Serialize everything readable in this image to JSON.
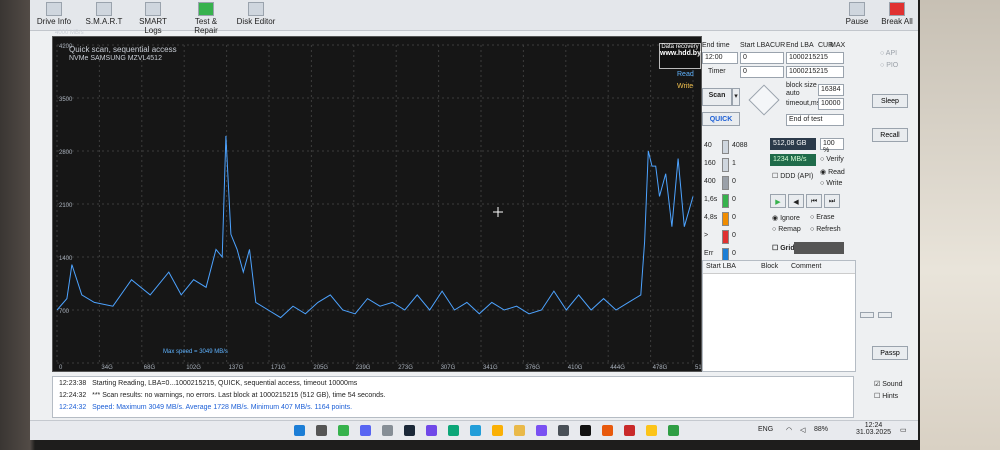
{
  "toolbar": {
    "items": [
      "Drive Info",
      "S.M.A.R.T",
      "SMART Logs",
      "Test & Repair",
      "Disk Editor"
    ],
    "pause": "Pause",
    "break_all": "Break All"
  },
  "chart": {
    "title": "Quick scan, sequential access",
    "drive": "NVMe SAMSUNG MZVL4512",
    "y_unit": "4000 MB/s",
    "data_recovery": "Data recovery",
    "site": "www.hdd.by",
    "read_label": "Read",
    "write_label": "Write",
    "max_speed": "Max speed = 3049 MB/s"
  },
  "chart_data": {
    "type": "line",
    "title": "Quick scan, sequential access",
    "ylabel": "4000 MB/s",
    "y_ticks": [
      "4200",
      "3500",
      "2800",
      "2100",
      "1400",
      "700"
    ],
    "x_ticks": [
      "0",
      "34G",
      "68G",
      "102G",
      "137G",
      "171G",
      "205G",
      "239G",
      "273G",
      "307G",
      "341G",
      "376G",
      "410G",
      "444G",
      "478G",
      "512G"
    ],
    "ylim": [
      0,
      4200
    ],
    "xlim": [
      0,
      512
    ],
    "series": [
      {
        "name": "Read",
        "x": [
          0,
          8,
          12,
          20,
          30,
          45,
          60,
          75,
          90,
          100,
          110,
          120,
          128,
          133,
          136,
          140,
          145,
          150,
          155,
          160,
          170,
          180,
          190,
          200,
          210,
          220,
          230,
          240,
          250,
          260,
          270,
          280,
          290,
          300,
          310,
          320,
          330,
          340,
          350,
          360,
          370,
          380,
          390,
          400,
          410,
          420,
          430,
          440,
          450,
          460,
          470,
          473,
          476,
          479,
          482,
          485,
          490,
          495,
          500,
          505,
          512
        ],
        "y": [
          700,
          850,
          1300,
          900,
          800,
          750,
          1100,
          900,
          1200,
          900,
          1100,
          1000,
          1500,
          1400,
          3000,
          1700,
          1500,
          1200,
          1500,
          800,
          700,
          600,
          750,
          650,
          800,
          900,
          700,
          650,
          850,
          750,
          800,
          700,
          900,
          700,
          950,
          700,
          800,
          650,
          800,
          700,
          750,
          650,
          700,
          950,
          700,
          900,
          700,
          850,
          700,
          800,
          900,
          1600,
          2800,
          2600,
          2600,
          2200,
          2500,
          1800,
          2700,
          1800,
          2200
        ]
      }
    ]
  },
  "panel": {
    "end_time": "End time",
    "start_lba": "Start LBA",
    "cur": "CUR",
    "end_lba": "End LBA",
    "max": "MAX",
    "time_value": "12:00",
    "start_lba_value": "0",
    "end_lba_value": "1000215215",
    "timer_label": "Timer",
    "timer_value": "0",
    "end_lba_value2": "1000215215",
    "block_size_label": "block size",
    "auto_label": "auto",
    "block_size_value": "16384",
    "timeout_label": "timeout,ms",
    "timeout_value": "10000",
    "scan_button": "Scan",
    "quick_button": "QUICK",
    "end_of_test": "End of test",
    "size_value": "512,08 GB",
    "percent_value": "100",
    "percent_sign": "%",
    "speed_value": "1234 MB/s",
    "verify": "Verify",
    "read": "Read",
    "write": "Write",
    "ddd_api": "DDD (API)",
    "ignore": "Ignore",
    "erase": "Erase",
    "remap": "Remap",
    "refresh": "Refresh",
    "grid_label": "Grid",
    "counters": [
      {
        "label": "40",
        "value": "4088",
        "color": "#cfd6de"
      },
      {
        "label": "160",
        "value": "1",
        "color": "#cfd6de"
      },
      {
        "label": "400",
        "value": "0",
        "color": "#9aa0a8"
      },
      {
        "label": "1,6s",
        "value": "0",
        "color": "#37b24d"
      },
      {
        "label": "4,8s",
        "value": "0",
        "color": "#f08c00"
      },
      {
        "label": ">",
        "value": "0",
        "color": "#e03131"
      },
      {
        "label": "Err",
        "value": "0",
        "color": "#1c7ed6"
      }
    ],
    "table_headers": [
      "Start LBA",
      "Block",
      "Comment"
    ]
  },
  "side": {
    "api": "API",
    "pio": "PIO",
    "sleep": "Sleep",
    "recall": "Recall",
    "passp": "Passp",
    "sound": "Sound",
    "hints": "Hints"
  },
  "log": [
    {
      "time": "12:23:38",
      "text": "Starting Reading, LBA=0...1000215215, QUICK, sequential access, timeout 10000ms",
      "color": "#222"
    },
    {
      "time": "12:24:32",
      "text": "*** Scan results: no warnings, no errors. Last block at 1000215215 (512 GB), time 54 seconds.",
      "color": "#222"
    },
    {
      "time": "12:24:32",
      "text": "Speed: Maximum 3049 MB/s. Average 1728 MB/s. Minimum 407 MB/s. 1164 points.",
      "color": "#1c5fd6"
    }
  ],
  "taskbar": {
    "lang": "ENG",
    "battery": "88%",
    "time": "12:24",
    "date": "31.03.2025"
  }
}
